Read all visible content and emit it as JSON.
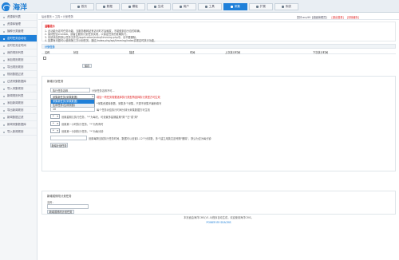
{
  "app": {
    "logo_text": "海洋"
  },
  "nav": {
    "items": [
      {
        "label": "首页",
        "icon": "home-icon"
      },
      {
        "label": "数据",
        "icon": "data-icon"
      },
      {
        "label": "模板",
        "icon": "template-icon"
      },
      {
        "label": "生成",
        "icon": "generate-icon"
      },
      {
        "label": "用户",
        "icon": "user-icon"
      },
      {
        "label": "工具",
        "icon": "tool-icon"
      },
      {
        "label": "采集",
        "icon": "collect-icon",
        "active": true
      },
      {
        "label": "扩展",
        "icon": "extend-icon"
      },
      {
        "label": "系统",
        "icon": "gear-icon"
      }
    ]
  },
  "sidebar": {
    "items": [
      {
        "label": "资源库列表"
      },
      {
        "label": "资源库管理"
      },
      {
        "label": "播种分类管理"
      },
      {
        "label": "定时任务自动化",
        "active": true
      },
      {
        "label": "定时任务定时间"
      },
      {
        "label": "我的规则列表"
      },
      {
        "label": "添加规则规则"
      },
      {
        "label": "导出规则规则"
      },
      {
        "label": "规则数据过滤"
      },
      {
        "label": "过滤采集数据库"
      },
      {
        "label": "导入采集规则"
      },
      {
        "label": "新闻规则列表"
      },
      {
        "label": "添加新闻规则"
      },
      {
        "label": "导出新闻规则"
      },
      {
        "label": "新闻数据过滤"
      },
      {
        "label": "新闻采集数据库"
      },
      {
        "label": "导入新闻规则"
      }
    ]
  },
  "breadcrumb": {
    "text": "后台首页 » 工具 » 计划任务"
  },
  "topinfo": {
    "user": "您好:any99【超级管理员】",
    "exit": "[退出登录]",
    "clear": "[清除缓存]"
  },
  "notice": {
    "title": "温馨提示",
    "lines": [
      "1. 此功能为定时任务功能，当服务器网站有访问时才会触发，不能做到百分百的精确。",
      "2. 最好配合crontab，或者云服务计划任务实现，以保证任务的准确执行。",
      "3. 系统添加的默认任务文件在/application/extra/timming.php中，请不要删除。",
      "4. 如果有问题可以使用第三方计划任务，通过/index.php/api/timming/index实现定时执行功能。"
    ]
  },
  "task_table": {
    "section_title": "计划任务",
    "headers": [
      "名称",
      "状态",
      "描述",
      "时间",
      "上次执行时间",
      "下次执行时间"
    ],
    "action_button": "保存"
  },
  "add_task": {
    "section_title": "新增计划任务",
    "name_placeholder": "执行任务名称",
    "name_hint": "计划任务名称不可...",
    "type_select_value": "采集新任务(采集数据)",
    "type_hint": "增加一项任务需要选择执行类型再选择执行类型方可生效",
    "dropdown_options": [
      {
        "label": "采集新任务(采集数据)",
        "selected": true
      },
      {
        "label": "生成任务(生成页面)",
        "selected": false
      }
    ],
    "params_hint": "*采集资源库参数、采集多个采集，只需不采集不编码填写",
    "interval_value": "10",
    "interval_hint": "每个任务对应执行时间分钟为采集数据方可生效",
    "weekday_label": "*",
    "weekday_hint": "设置星期几执行任务，\"*\"为每天，可设置多星期星期\"周\"\"日\"或\"周\"",
    "hour_label": "*",
    "hour_hint": "设置某一小时执行任务，\"*\"为所有时",
    "minute_label": "*",
    "minute_hint": "设置某一分钟执行任务，\"*\"为每分钟",
    "time_hint": "设置每隔当前执行任务时间，数据可以设置1-12个分钟数，多个建立用英文逗号隔\"删除\"，默认为空为每分钟",
    "submit_button": "新增计划任务"
  },
  "edit_task": {
    "section_title": "新增或修改计划任务",
    "name_label": "名称：",
    "submit_button": "新增或修改计划任务"
  },
  "footer": {
    "line1": "本页面由海洋CMS(V1.0)程序自动生成，欢迎使用海洋CMS。",
    "line2": "POWER BY SEACMS"
  }
}
